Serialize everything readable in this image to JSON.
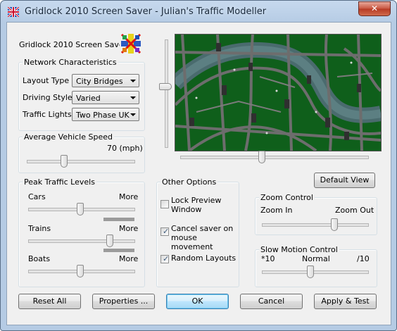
{
  "window": {
    "title": "Gridlock 2010 Screen Saver - Julian's Traffic Modeller",
    "close_glyph": "✕"
  },
  "header": {
    "app_name": "Gridlock 2010 Screen Saver"
  },
  "network": {
    "group_label": "Network Characteristics",
    "layout_type": {
      "label": "Layout Type",
      "value": "City Bridges"
    },
    "driving_style": {
      "label": "Driving Style",
      "value": "Varied"
    },
    "traffic_lights": {
      "label": "Traffic Lights",
      "value": "Two Phase UK"
    }
  },
  "speed": {
    "group_label": "Average Vehicle Speed",
    "value_text": "70 (mph)"
  },
  "traffic": {
    "group_label": "Peak Traffic Levels",
    "rows": [
      {
        "label": "Cars",
        "more": "More",
        "level": 0.45
      },
      {
        "label": "Trains",
        "more": "More",
        "level": 0.85
      },
      {
        "label": "Boats",
        "more": "More",
        "level": 0.45
      }
    ]
  },
  "options": {
    "group_label": "Other Options",
    "items": [
      {
        "label": "Lock Preview Window",
        "checked": false
      },
      {
        "label": "Cancel saver on mouse movement",
        "checked": true
      },
      {
        "label": "Random Layouts",
        "checked": true
      }
    ]
  },
  "preview": {
    "default_view_label": "Default View"
  },
  "zoom": {
    "group_label": "Zoom Control",
    "min_label": "Zoom In",
    "max_label": "Zoom Out"
  },
  "slowmo": {
    "group_label": "Slow Motion Control",
    "min_label": "*10",
    "mid_label": "Normal",
    "max_label": "/10"
  },
  "buttons": {
    "reset": "Reset All",
    "properties": "Properties ...",
    "ok": "OK",
    "cancel": "Cancel",
    "apply": "Apply & Test"
  },
  "colors": {
    "map_bg": "#0f5f1b",
    "river": "#4a6b6e",
    "road": "#6d6d6d"
  }
}
